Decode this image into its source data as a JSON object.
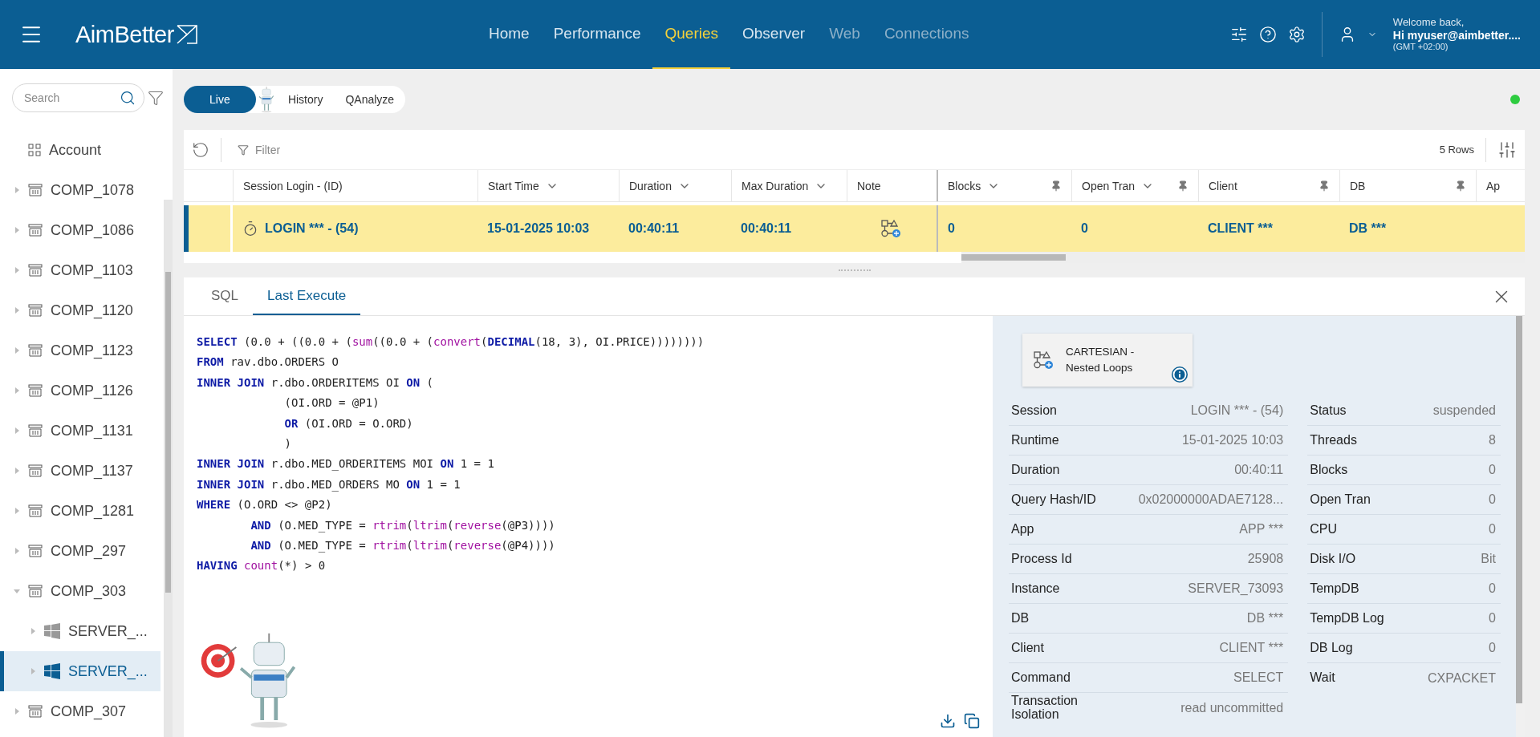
{
  "header": {
    "logo": "AimBetter",
    "nav": [
      {
        "label": "Home",
        "selected": false,
        "disabled": false
      },
      {
        "label": "Performance",
        "selected": false,
        "disabled": false
      },
      {
        "label": "Queries",
        "selected": true,
        "disabled": false
      },
      {
        "label": "Observer",
        "selected": false,
        "disabled": false
      },
      {
        "label": "Web",
        "selected": false,
        "disabled": true
      },
      {
        "label": "Connections",
        "selected": false,
        "disabled": true
      }
    ],
    "user": {
      "greeting": "Welcome back,",
      "name": "Hi myuser@aimbetter....",
      "timezone": "(GMT +02:00)"
    }
  },
  "sidebar": {
    "search": {
      "placeholder": "Search"
    },
    "items": [
      {
        "label": "Account",
        "kind": "account",
        "selected": false
      },
      {
        "label": "COMP_1078",
        "kind": "company",
        "expanded": false,
        "selected": false
      },
      {
        "label": "COMP_1086",
        "kind": "company",
        "expanded": false,
        "selected": false
      },
      {
        "label": "COMP_1103",
        "kind": "company",
        "expanded": false,
        "selected": false
      },
      {
        "label": "COMP_1120",
        "kind": "company",
        "expanded": false,
        "selected": false
      },
      {
        "label": "COMP_1123",
        "kind": "company",
        "expanded": false,
        "selected": false
      },
      {
        "label": "COMP_1126",
        "kind": "company",
        "expanded": false,
        "selected": false
      },
      {
        "label": "COMP_1131",
        "kind": "company",
        "expanded": false,
        "selected": false
      },
      {
        "label": "COMP_1137",
        "kind": "company",
        "expanded": false,
        "selected": false
      },
      {
        "label": "COMP_1281",
        "kind": "company",
        "expanded": false,
        "selected": false
      },
      {
        "label": "COMP_297",
        "kind": "company",
        "expanded": false,
        "selected": false
      },
      {
        "label": "COMP_303",
        "kind": "company",
        "expanded": true,
        "selected": false,
        "children": [
          {
            "label": "SERVER_...",
            "kind": "server",
            "expanded": false,
            "selected": false
          },
          {
            "label": "SERVER_...",
            "kind": "server",
            "expanded": false,
            "selected": true
          }
        ]
      },
      {
        "label": "COMP_307",
        "kind": "company",
        "expanded": false,
        "selected": false
      }
    ]
  },
  "mode_tabs": [
    {
      "label": "Live",
      "selected": true
    },
    {
      "label": "History",
      "selected": false
    },
    {
      "label": "QAnalyze",
      "selected": false
    }
  ],
  "grid": {
    "filter": {
      "placeholder": "Filter"
    },
    "row_count": "5 Rows",
    "columns": [
      {
        "label": "Session Login - (ID)",
        "sortable": false,
        "pinned": false
      },
      {
        "label": "Start Time",
        "sortable": true,
        "pinned": false
      },
      {
        "label": "Duration",
        "sortable": true,
        "pinned": false
      },
      {
        "label": "Max Duration",
        "sortable": true,
        "pinned": false
      },
      {
        "label": "Note",
        "sortable": false,
        "pinned": false
      },
      {
        "label": "Blocks",
        "sortable": true,
        "pinned": true
      },
      {
        "label": "Open Tran",
        "sortable": true,
        "pinned": true
      },
      {
        "label": "Client",
        "sortable": false,
        "pinned": true
      },
      {
        "label": "DB",
        "sortable": false,
        "pinned": true
      },
      {
        "label": "Ap"
      }
    ],
    "rows": [
      {
        "selected": true,
        "cells": [
          "LOGIN *** - (54)",
          "15-01-2025 10:03",
          "00:40:11",
          "00:40:11",
          "",
          "0",
          "0",
          "CLIENT ***",
          "DB ***",
          ""
        ]
      }
    ]
  },
  "detail_tabs": [
    {
      "label": "SQL",
      "selected": false
    },
    {
      "label": "Last Execute",
      "selected": true
    }
  ],
  "sql": [
    {
      "kind": "top",
      "tokens": [
        {
          "text": "SELECT",
          "kind": "keyword"
        },
        {
          "text": " (0.0 + ((0.0 + (",
          "kind": "plain"
        },
        {
          "text": "sum",
          "kind": "function"
        },
        {
          "text": "((0.0 + (",
          "kind": "plain"
        },
        {
          "text": "convert",
          "kind": "function"
        },
        {
          "text": "(",
          "kind": "plain"
        },
        {
          "text": "DECIMAL",
          "kind": "keyword"
        },
        {
          "text": "(18, 3), OI.PRICE))))))))",
          "kind": "plain"
        }
      ]
    },
    {
      "kind": "top",
      "tokens": [
        {
          "text": "FROM",
          "kind": "keyword"
        },
        {
          "text": " rav.dbo.ORDERS O",
          "kind": "plain"
        }
      ]
    },
    {
      "kind": "top",
      "tokens": [
        {
          "text": "INNER JOIN",
          "kind": "keyword"
        },
        {
          "text": " r.dbo.ORDERITEMS OI ",
          "kind": "plain"
        },
        {
          "text": "ON",
          "kind": "keyword"
        },
        {
          "text": " (",
          "kind": "plain"
        }
      ]
    },
    {
      "kind": "group",
      "tokens": [
        {
          "text": "(OI.ORD = @P1)",
          "kind": "plain"
        }
      ]
    },
    {
      "kind": "group",
      "tokens": [
        {
          "text": "OR",
          "kind": "keyword"
        },
        {
          "text": " (OI.ORD = O.ORD)",
          "kind": "plain"
        }
      ]
    },
    {
      "kind": "group",
      "tokens": [
        {
          "text": ")",
          "kind": "plain"
        }
      ]
    },
    {
      "kind": "top",
      "tokens": [
        {
          "text": "INNER JOIN",
          "kind": "keyword"
        },
        {
          "text": " r.dbo.MED_ORDERITEMS MOI ",
          "kind": "plain"
        },
        {
          "text": "ON",
          "kind": "keyword"
        },
        {
          "text": " 1 = 1",
          "kind": "plain"
        }
      ]
    },
    {
      "kind": "top",
      "tokens": [
        {
          "text": "INNER JOIN",
          "kind": "keyword"
        },
        {
          "text": " r.dbo.MED_ORDERS MO ",
          "kind": "plain"
        },
        {
          "text": "ON",
          "kind": "keyword"
        },
        {
          "text": " 1 = 1",
          "kind": "plain"
        }
      ]
    },
    {
      "kind": "top",
      "tokens": [
        {
          "text": "WHERE",
          "kind": "keyword"
        },
        {
          "text": " (O.ORD <> @P2)",
          "kind": "plain"
        }
      ]
    },
    {
      "kind": "condition",
      "tokens": [
        {
          "text": "AND",
          "kind": "keyword"
        },
        {
          "text": " (O.MED_TYPE = ",
          "kind": "plain"
        },
        {
          "text": "rtrim",
          "kind": "function"
        },
        {
          "text": "(",
          "kind": "plain"
        },
        {
          "text": "ltrim",
          "kind": "function"
        },
        {
          "text": "(",
          "kind": "plain"
        },
        {
          "text": "reverse",
          "kind": "function"
        },
        {
          "text": "(@P3))))",
          "kind": "plain"
        }
      ]
    },
    {
      "kind": "condition",
      "tokens": [
        {
          "text": "AND",
          "kind": "keyword"
        },
        {
          "text": " (O.MED_TYPE = ",
          "kind": "plain"
        },
        {
          "text": "rtrim",
          "kind": "function"
        },
        {
          "text": "(",
          "kind": "plain"
        },
        {
          "text": "ltrim",
          "kind": "function"
        },
        {
          "text": "(",
          "kind": "plain"
        },
        {
          "text": "reverse",
          "kind": "function"
        },
        {
          "text": "(@P4))))",
          "kind": "plain"
        }
      ]
    },
    {
      "kind": "top",
      "tokens": [
        {
          "text": "HAVING ",
          "kind": "keyword"
        },
        {
          "text": "count",
          "kind": "function"
        },
        {
          "text": "(*) > 0",
          "kind": "plain"
        }
      ]
    }
  ],
  "plan": {
    "label": "CARTESIAN - Nested Loops"
  },
  "details_left": [
    {
      "label": "Session",
      "value": "LOGIN *** - (54)"
    },
    {
      "label": "Runtime",
      "value": "15-01-2025 10:03"
    },
    {
      "label": "Duration",
      "value": "00:40:11"
    },
    {
      "label": "Query Hash/ID",
      "value": "0x02000000ADAE7128..."
    },
    {
      "label": "App",
      "value": "APP ***"
    },
    {
      "label": "Process Id",
      "value": "25908"
    },
    {
      "label": "Instance",
      "value": "SERVER_73093"
    },
    {
      "label": "DB",
      "value": "DB ***"
    },
    {
      "label": "Client",
      "value": "CLIENT ***"
    },
    {
      "label": "Command",
      "value": "SELECT"
    },
    {
      "label": "Transaction Isolation",
      "value": "read uncommitted"
    }
  ],
  "details_right": [
    {
      "label": "Status",
      "value": "suspended"
    },
    {
      "label": "Threads",
      "value": "8"
    },
    {
      "label": "Blocks",
      "value": "0"
    },
    {
      "label": "Open Tran",
      "value": "0"
    },
    {
      "label": "CPU",
      "value": "0"
    },
    {
      "label": "Disk I/O",
      "value": "Bit"
    },
    {
      "label": "TempDB",
      "value": "0"
    },
    {
      "label": "TempDB Log",
      "value": "0"
    },
    {
      "label": "DB Log",
      "value": "0"
    },
    {
      "label": "Wait",
      "value": "CXPACKET"
    }
  ]
}
